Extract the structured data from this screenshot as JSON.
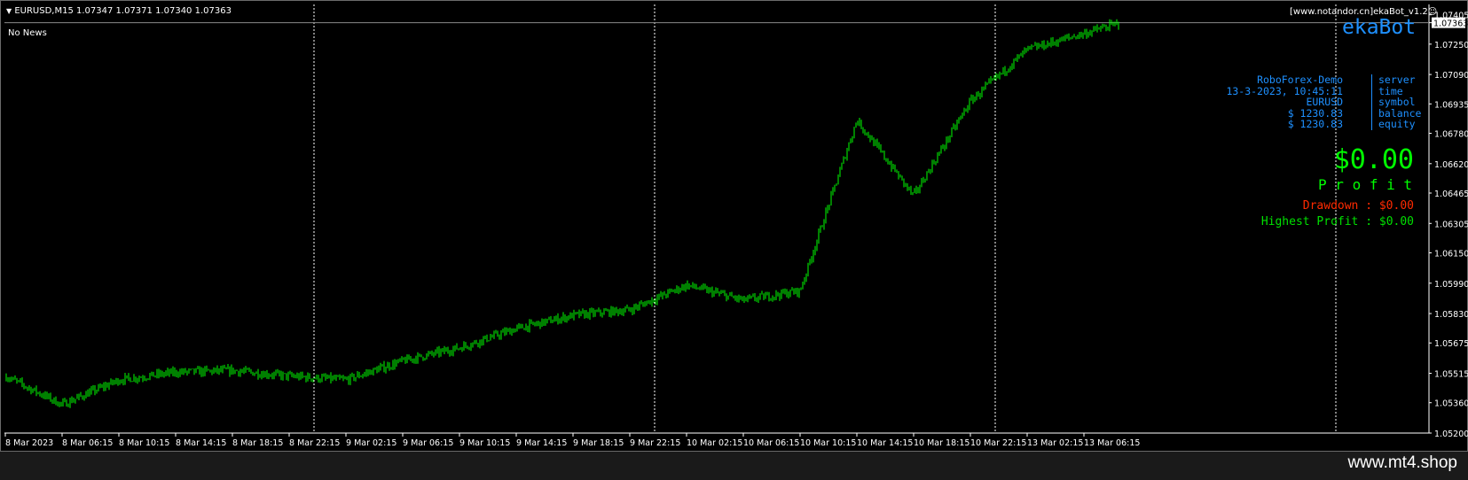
{
  "header": {
    "title": "EURUSD,M15  1.07347 1.07371 1.07340 1.07363",
    "news": "No News",
    "url_label": "[www.notandor.cn]ekaBot_v1.2",
    "ea_icon": "smiley-icon"
  },
  "ekabot": {
    "name": "ekaBot",
    "info": [
      {
        "value": "RoboForex-Demo",
        "key": "server"
      },
      {
        "value": "13-3-2023, 10:45:11",
        "key": "time"
      },
      {
        "value": "EURUSD",
        "key": "symbol"
      },
      {
        "value": "$ 1230.83",
        "key": "balance"
      },
      {
        "value": "$ 1230.83",
        "key": "equity"
      }
    ],
    "profit_value": "$0.00",
    "profit_label": "P r o f i t",
    "drawdown": "Drawdown : $0.00",
    "highest_profit": "Highest Profit : $0.00"
  },
  "footer": {
    "watermark": "www.mt4.shop"
  },
  "colors": {
    "background": "#000000",
    "candles": "#00ff00",
    "info_text": "#1e90ff",
    "ekabot_title": "#1e90ff",
    "profit": "#00ff00",
    "drawdown": "#ff2a00",
    "highest_profit": "#00e000",
    "grid": "#ffffff"
  },
  "chart_data": {
    "type": "candlestick",
    "symbol": "EURUSD",
    "timeframe": "M15",
    "ylim": [
      1.052,
      1.0745
    ],
    "current_price": "1.07363",
    "price_ticks": [
      "1.07405",
      "1.07363",
      "1.07250",
      "1.07090",
      "1.06935",
      "1.06780",
      "1.06620",
      "1.06465",
      "1.06305",
      "1.06150",
      "1.05990",
      "1.05830",
      "1.05675",
      "1.05515",
      "1.05360",
      "1.05200"
    ],
    "time_ticks": [
      "8 Mar 2023",
      "8 Mar 06:15",
      "8 Mar 10:15",
      "8 Mar 14:15",
      "8 Mar 18:15",
      "8 Mar 22:15",
      "9 Mar 02:15",
      "9 Mar 06:15",
      "9 Mar 10:15",
      "9 Mar 14:15",
      "9 Mar 18:15",
      "9 Mar 22:15",
      "10 Mar 02:15",
      "10 Mar 06:15",
      "10 Mar 10:15",
      "10 Mar 14:15",
      "10 Mar 18:15",
      "10 Mar 22:15",
      "13 Mar 02:15",
      "13 Mar 06:15"
    ],
    "day_separators": [
      "9 Mar",
      "10 Mar",
      "13 Mar",
      "14 Mar"
    ],
    "price_path": [
      {
        "t": "8 Mar 2023",
        "p": 1.055
      },
      {
        "t": "8 Mar 06:15",
        "p": 1.0535
      },
      {
        "t": "8 Mar 10:15",
        "p": 1.0548
      },
      {
        "t": "8 Mar 14:15",
        "p": 1.0552
      },
      {
        "t": "8 Mar 18:15",
        "p": 1.0553
      },
      {
        "t": "8 Mar 22:15",
        "p": 1.055
      },
      {
        "t": "9 Mar 02:15",
        "p": 1.0548
      },
      {
        "t": "9 Mar 06:15",
        "p": 1.0558
      },
      {
        "t": "9 Mar 10:15",
        "p": 1.0565
      },
      {
        "t": "9 Mar 14:15",
        "p": 1.0575
      },
      {
        "t": "9 Mar 18:15",
        "p": 1.0582
      },
      {
        "t": "9 Mar 22:15",
        "p": 1.0585
      },
      {
        "t": "10 Mar 02:15",
        "p": 1.0598
      },
      {
        "t": "10 Mar 06:15",
        "p": 1.059
      },
      {
        "t": "10 Mar 10:15",
        "p": 1.0595
      },
      {
        "t": "10 Mar 14:15",
        "p": 1.0685
      },
      {
        "t": "10 Mar 18:15",
        "p": 1.0645
      },
      {
        "t": "10 Mar 22:15",
        "p": 1.0695
      },
      {
        "t": "13 Mar 02:15",
        "p": 1.0722
      },
      {
        "t": "13 Mar 06:15",
        "p": 1.0736
      }
    ]
  }
}
